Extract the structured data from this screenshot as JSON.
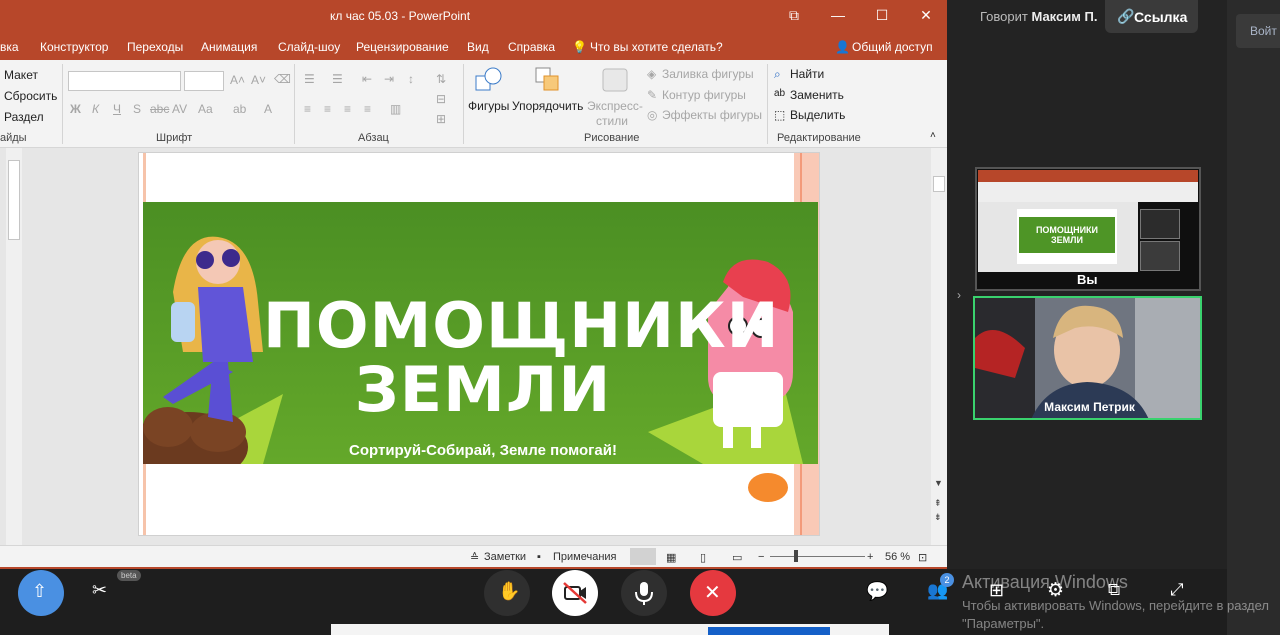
{
  "window": {
    "title": "кл час 05.03  -  PowerPoint"
  },
  "menu": [
    "вка",
    "Конструктор",
    "Переходы",
    "Анимация",
    "Слайд-шоу",
    "Рецензирование",
    "Вид",
    "Справка",
    "Что вы хотите сделать?",
    "Общий доступ"
  ],
  "ribbon": {
    "layout": "Макет",
    "reset": "Сбросить",
    "section": "Раздел",
    "group_slides": "айды",
    "group_font": "Шрифт",
    "group_para": "Абзац",
    "shapes": "Фигуры",
    "arrange": "Упорядочить",
    "express1": "Экспресс-",
    "express2": "стили",
    "fill": "Заливка фигуры",
    "outline": "Контур фигуры",
    "effects": "Эффекты фигуры",
    "group_draw": "Рисование",
    "find": "Найти",
    "replace": "Заменить",
    "select": "Выделить",
    "group_edit": "Редактирование"
  },
  "slide": {
    "title1": "ПОМОЩНИКИ",
    "title2": "ЗЕМЛИ",
    "tagline": "Сортируй-Собирай, Земле помогай!"
  },
  "status": {
    "notes": "Заметки",
    "comments": "Примечания",
    "zoom": "56 %"
  },
  "meeting": {
    "speaker_prefix": "Говорит",
    "speaker": "Максим П.",
    "link": "Ссылка",
    "you": "Вы",
    "participant": "Максим Петрик",
    "participants_count": "2",
    "beta": "beta",
    "side_text": "Войт",
    "mini_title1": "ПОМОЩНИКИ",
    "mini_title2": "ЗЕМЛИ"
  },
  "activation": {
    "title": "Активация Windows",
    "text": "Чтобы активировать Windows, перейдите в раздел \"Параметры\"."
  }
}
